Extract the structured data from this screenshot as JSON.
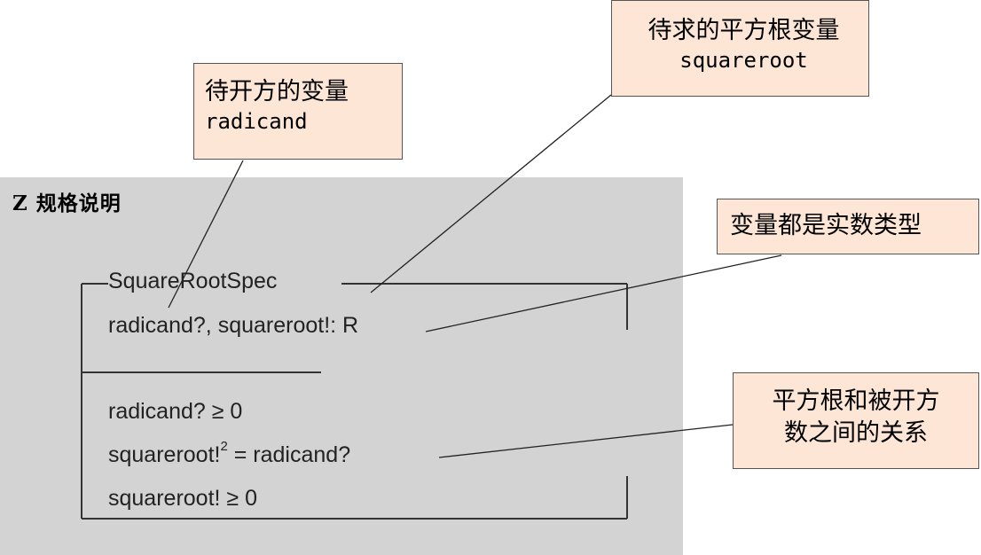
{
  "panel": {
    "title": "Z 规格说明",
    "background": "#d3d3d3"
  },
  "schema": {
    "name": "SquareRootSpec",
    "declaration": "radicand?, squareroot!: R",
    "predicates": {
      "p1": "radicand? ≥ 0",
      "p2_left": "squareroot!",
      "p2_exp": "2",
      "p2_right": " = radicand?",
      "p3": "squareroot! ≥ 0"
    }
  },
  "callouts": {
    "radicand": {
      "zh": "待开方的变量",
      "en": "radicand"
    },
    "squareroot": {
      "zh": "待求的平方根变量",
      "en": "squareroot"
    },
    "real_type": {
      "zh": "变量都是实数类型"
    },
    "relation": {
      "line1": "平方根和被开方",
      "line2": "数之间的关系"
    }
  },
  "colors": {
    "callout_fill": "#fde6d6",
    "callout_border": "#555555",
    "schema_line": "#333333"
  }
}
